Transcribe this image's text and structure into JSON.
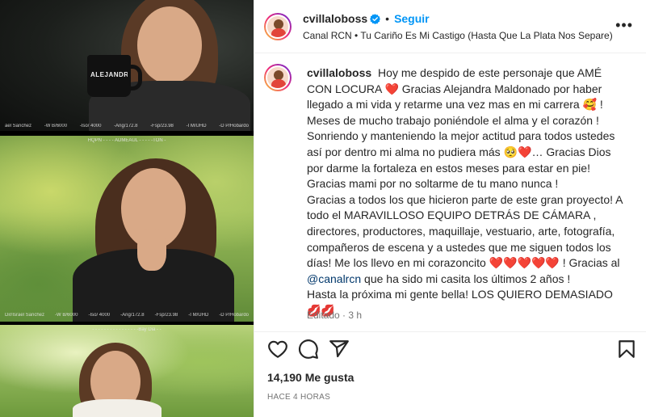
{
  "media": {
    "frame1": {
      "mug_text": "ALEJANDR",
      "overlay_left": "ael Sanchez",
      "overlay_items": [
        "-W B/6000",
        "-Iso/ 4000",
        "-Ang/172.8",
        "-Fsp/23.98",
        "-I M/UHD",
        "-D P/Hobardo"
      ]
    },
    "frame2": {
      "overlay_top": "HQPN - - - - ADMEAUL - - - - -TON -",
      "overlay_left": "Dir/Israel Sanchez",
      "overlay_items": [
        "-W B/6000",
        "-Iso/ 4000",
        "-Ang/172.8",
        "-Fsp/23.98",
        "-I M/UHD",
        "-D P/Hobardo"
      ]
    },
    "frame3": {
      "overlay_top": "- - - - - - - - - - - - - - - -Bay Dia - -"
    }
  },
  "header": {
    "username": "cvillaloboss",
    "separator": "•",
    "follow_label": "Seguir",
    "subtitle": "Canal RCN • Tu Cariño Es Mi Castigo (Hasta Que La Plata Nos Separe)",
    "more": "•••"
  },
  "caption": {
    "username": "cvillaloboss",
    "p1": "Hoy me despido de este personaje que AMÉ CON LOCURA",
    "p1_emoji": "❤️",
    "p2": "Gracias Alejandra Maldonado por haber llegado a mi vida y retarme una vez mas en mi carrera",
    "p2_emoji": "🥰",
    "p3": "! Meses de mucho trabajo poniéndole el alma y el corazón ! Sonriendo y manteniendo la mejor actitud para todos ustedes así por dentro mi alma no pudiera más",
    "p3_emoji": "🥺❤️",
    "p4": "… Gracias Dios por darme la fortaleza en estos meses para estar en pie! Gracias mami por no soltarme de tu mano nunca !",
    "p5": "Gracias a todos los que hicieron parte de este gran proyecto! A todo el MARAVILLOSO EQUIPO DETRÁS DE CÁMARA , directores, productores, maquillaje, vestuario, arte, fotografía, compañeros de escena y a ustedes que me siguen todos los días! Me los llevo en mi corazoncito",
    "p5_emoji": "❤️❤️❤️❤️❤️",
    "p6": "! Gracias al",
    "mention": "@canalrcn",
    "p7": "que ha sido mi casita los últimos 2 años !",
    "p8": "Hasta la próxima mi gente bella! LOS QUIERO DEMASIADO",
    "p8_emoji": "💋💋",
    "edited": "Editado · 3 h"
  },
  "actions": {
    "likes": "14,190 Me gusta",
    "time_ago": "HACE 4 HORAS"
  },
  "colors": {
    "accent": "#0095f6",
    "text": "#262626",
    "muted": "#737373",
    "border": "#efefef",
    "heart": "#ed1c24"
  },
  "icons": [
    "verified-badge-icon",
    "more-options-icon",
    "heart-icon",
    "comment-icon",
    "share-icon",
    "bookmark-icon"
  ]
}
